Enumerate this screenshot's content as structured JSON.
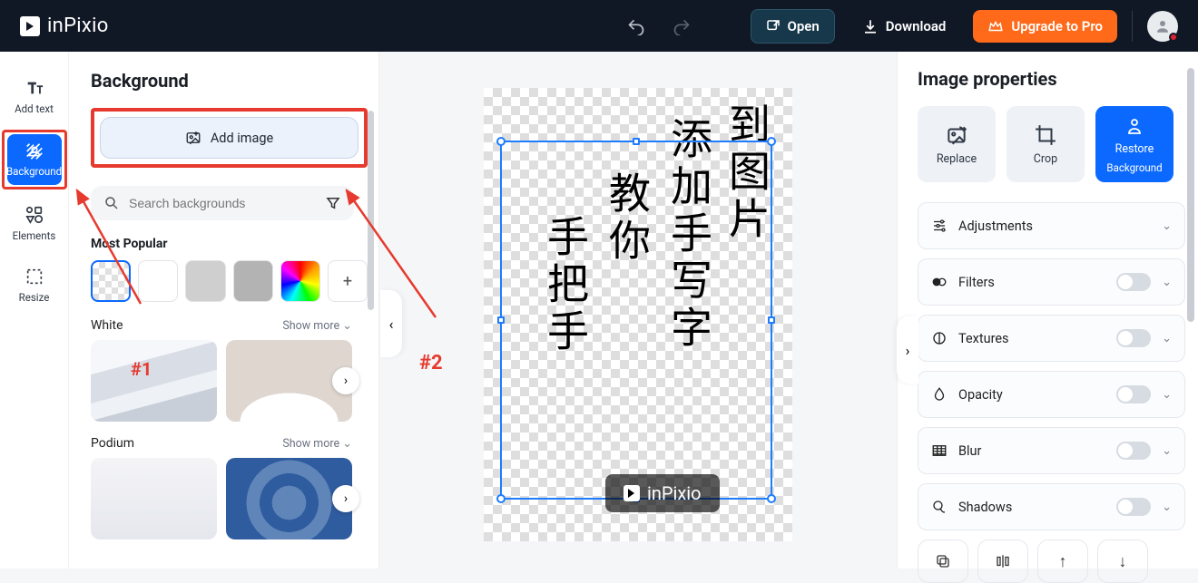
{
  "app": {
    "name": "inPixio"
  },
  "topbar": {
    "open_label": "Open",
    "download_label": "Download",
    "upgrade_label": "Upgrade to Pro"
  },
  "rail": {
    "add_text": "Add text",
    "background": "Background",
    "elements": "Elements",
    "resize": "Resize"
  },
  "panel": {
    "title": "Background",
    "add_image_label": "Add image",
    "search_placeholder": "Search backgrounds",
    "most_popular": "Most Popular",
    "category_white": "White",
    "category_podium": "Podium",
    "show_more": "Show more"
  },
  "canvas": {
    "watermark_text": "inPixio",
    "text_col1": "到图片",
    "text_col2": "添加手写字",
    "text_col3": "教你",
    "text_col4": "手把手"
  },
  "props": {
    "title": "Image properties",
    "replace": "Replace",
    "crop": "Crop",
    "restore_line1": "Restore",
    "restore_line2": "Background",
    "adjustments": "Adjustments",
    "filters": "Filters",
    "textures": "Textures",
    "opacity": "Opacity",
    "blur": "Blur",
    "shadows": "Shadows"
  },
  "annotations": {
    "n1": "#1",
    "n2": "#2"
  }
}
